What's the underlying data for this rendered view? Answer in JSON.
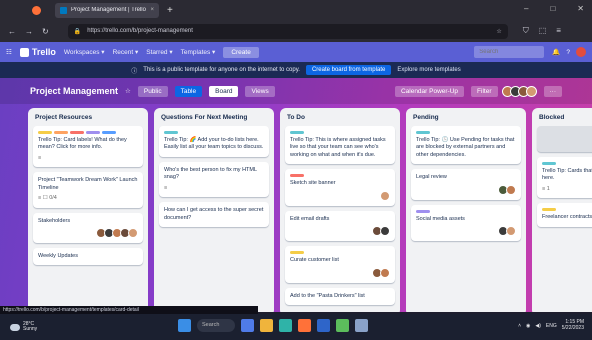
{
  "browser": {
    "tab_title": "Project Management | Trello",
    "tab_close": "×",
    "new_tab": "+",
    "url": "https://trello.com/b/project-management",
    "win_min": "–",
    "win_max": "□",
    "win_close": "✕",
    "back": "←",
    "forward": "→",
    "reload": "↻",
    "menu": "≡"
  },
  "trello_header": {
    "menu_glyph": "☷",
    "logo": "Trello",
    "menus": [
      "Workspaces ▾",
      "Recent ▾",
      "Starred ▾",
      "Templates ▾"
    ],
    "create": "Create",
    "search_placeholder": "Search"
  },
  "banner": {
    "text": "This is a public template for anyone on the internet to copy.",
    "button": "Create board from template",
    "link": "Explore more templates"
  },
  "board": {
    "title": "Project Management",
    "star": "☆",
    "visibility": "Public",
    "table_view": "Table",
    "board_view": "Board",
    "more_views": "Views",
    "calendar": "Calendar Power-Up",
    "filter": "Filter",
    "more": "···"
  },
  "lists": [
    {
      "title": "Project Resources",
      "cards": [
        {
          "text": "Trello Tip: Card labels! What do they mean? Click for more info.",
          "labels": [
            "#f5cd47",
            "#fea362",
            "#f87168",
            "#9f8fef",
            "#579dff"
          ],
          "people": [],
          "foot": "≡"
        },
        {
          "text": "Project \"Teamwork Dream Work\" Launch Timeline",
          "labels": [],
          "people": [],
          "foot": "≡  ☐ 0/4"
        },
        {
          "text": "Stakeholders",
          "labels": [],
          "people": [
            "#8a5a3c",
            "#3b3b3b",
            "#c07a4f",
            "#6b4b3a",
            "#d39a72"
          ],
          "foot": ""
        },
        {
          "text": "Weekly Updates",
          "labels": [],
          "people": [],
          "foot": ""
        }
      ],
      "add": ""
    },
    {
      "title": "Questions For Next Meeting",
      "cards": [
        {
          "text": "Trello Tip: 🌈 Add your to-do lists here. Easily list all your team topics to discuss.",
          "labels": [
            "#60c6d2"
          ],
          "people": [],
          "foot": ""
        },
        {
          "text": "Who's the best person to fix my HTML snag?",
          "labels": [],
          "people": [],
          "foot": "≡"
        },
        {
          "text": "How can I get access to the super secret document?",
          "labels": [],
          "people": [],
          "foot": ""
        }
      ],
      "add": ""
    },
    {
      "title": "To Do",
      "cards": [
        {
          "text": "Trello Tip: This is where assigned tasks live so that your team can see who's working on what and when it's due.",
          "labels": [
            "#60c6d2"
          ],
          "people": [],
          "foot": ""
        },
        {
          "text": "Sketch site banner",
          "labels": [
            "#f87168"
          ],
          "people": [
            "#d39a72"
          ],
          "foot": ""
        },
        {
          "text": "Edit email drafts",
          "labels": [],
          "people": [
            "#6b4b3a",
            "#3b3b3b"
          ],
          "foot": ""
        },
        {
          "text": "Curate customer list",
          "labels": [
            "#f5cd47"
          ],
          "people": [
            "#8a5a3c",
            "#c07a4f"
          ],
          "foot": ""
        },
        {
          "text": "Add to the \"Pasta Drinkers\" list",
          "labels": [],
          "people": [],
          "foot": ""
        }
      ],
      "add": ""
    },
    {
      "title": "Pending",
      "cards": [
        {
          "text": "Trello Tip: 🕒 Use Pending for tasks that are blocked by external partners and other dependencies.",
          "labels": [
            "#60c6d2"
          ],
          "people": [],
          "foot": ""
        },
        {
          "text": "Legal review",
          "labels": [],
          "people": [
            "#4b5b3a",
            "#c07a4f"
          ],
          "foot": ""
        },
        {
          "text": "Social media assets",
          "labels": [
            "#9f8fef"
          ],
          "people": [
            "#3b3b3b",
            "#d39a72"
          ],
          "foot": ""
        }
      ],
      "add": ""
    },
    {
      "title": "Blocked",
      "cards": [
        {
          "text": "",
          "labels": [],
          "people": [],
          "foot": ""
        },
        {
          "text": "Trello Tip: Cards that are blocked stay here.",
          "labels": [
            "#60c6d2"
          ],
          "people": [],
          "foot": "≡ 1"
        },
        {
          "text": "Freelancer contracts",
          "labels": [
            "#f5cd47"
          ],
          "people": [],
          "foot": ""
        }
      ],
      "add": ""
    }
  ],
  "statusbar": {
    "text": "https://trello.com/b/project-management/templates/card-detail"
  },
  "taskbar": {
    "temp": "28°C",
    "weather": "Sunny",
    "search": "Search",
    "time": "1:15 PM",
    "date": "5/22/2023",
    "lang": "ENG"
  }
}
